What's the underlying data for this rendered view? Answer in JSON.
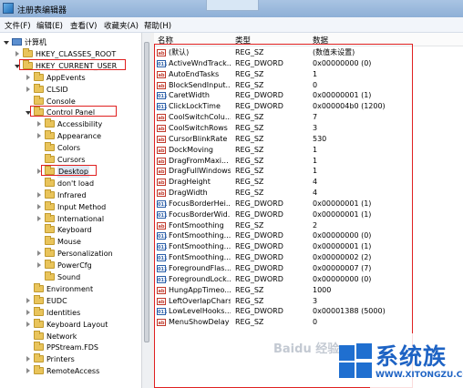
{
  "window": {
    "title": "注册表编辑器"
  },
  "menu": [
    "文件(F)",
    "编辑(E)",
    "查看(V)",
    "收藏夹(A)",
    "帮助(H)"
  ],
  "tree": [
    {
      "label": "计算机",
      "level": 0,
      "state": "open",
      "icon": "computer-icon"
    },
    {
      "label": "HKEY_CLASSES_ROOT",
      "level": 1,
      "state": "closed",
      "icon": "folder-icon"
    },
    {
      "label": "HKEY_CURRENT_USER",
      "level": 1,
      "state": "open",
      "icon": "folder-icon",
      "highlight": true
    },
    {
      "label": "AppEvents",
      "level": 2,
      "state": "closed",
      "icon": "folder-icon"
    },
    {
      "label": "CLSID",
      "level": 2,
      "state": "closed",
      "icon": "folder-icon"
    },
    {
      "label": "Console",
      "level": 2,
      "state": "none",
      "icon": "folder-icon"
    },
    {
      "label": "Control Panel",
      "level": 2,
      "state": "open",
      "icon": "folder-icon",
      "highlight": true
    },
    {
      "label": "Accessibility",
      "level": 3,
      "state": "closed",
      "icon": "folder-icon"
    },
    {
      "label": "Appearance",
      "level": 3,
      "state": "closed",
      "icon": "folder-icon"
    },
    {
      "label": "Colors",
      "level": 3,
      "state": "none",
      "icon": "folder-icon"
    },
    {
      "label": "Cursors",
      "level": 3,
      "state": "none",
      "icon": "folder-icon"
    },
    {
      "label": "Desktop",
      "level": 3,
      "state": "closed",
      "icon": "folder-icon",
      "highlight": true,
      "selected": true
    },
    {
      "label": "don't load",
      "level": 3,
      "state": "none",
      "icon": "folder-icon"
    },
    {
      "label": "Infrared",
      "level": 3,
      "state": "closed",
      "icon": "folder-icon"
    },
    {
      "label": "Input Method",
      "level": 3,
      "state": "closed",
      "icon": "folder-icon"
    },
    {
      "label": "International",
      "level": 3,
      "state": "closed",
      "icon": "folder-icon"
    },
    {
      "label": "Keyboard",
      "level": 3,
      "state": "none",
      "icon": "folder-icon"
    },
    {
      "label": "Mouse",
      "level": 3,
      "state": "none",
      "icon": "folder-icon"
    },
    {
      "label": "Personalization",
      "level": 3,
      "state": "closed",
      "icon": "folder-icon"
    },
    {
      "label": "PowerCfg",
      "level": 3,
      "state": "closed",
      "icon": "folder-icon"
    },
    {
      "label": "Sound",
      "level": 3,
      "state": "none",
      "icon": "folder-icon"
    },
    {
      "label": "Environment",
      "level": 2,
      "state": "none",
      "icon": "folder-icon"
    },
    {
      "label": "EUDC",
      "level": 2,
      "state": "closed",
      "icon": "folder-icon"
    },
    {
      "label": "Identities",
      "level": 2,
      "state": "closed",
      "icon": "folder-icon"
    },
    {
      "label": "Keyboard Layout",
      "level": 2,
      "state": "closed",
      "icon": "folder-icon"
    },
    {
      "label": "Network",
      "level": 2,
      "state": "none",
      "icon": "folder-icon"
    },
    {
      "label": "PPStream.FDS",
      "level": 2,
      "state": "none",
      "icon": "folder-icon"
    },
    {
      "label": "Printers",
      "level": 2,
      "state": "closed",
      "icon": "folder-icon"
    },
    {
      "label": "RemoteAccess",
      "level": 2,
      "state": "closed",
      "icon": "folder-icon"
    }
  ],
  "columns": {
    "name": "名称",
    "type": "类型",
    "data": "数据"
  },
  "values": [
    {
      "name": "(默认)",
      "type": "REG_SZ",
      "data": "(数值未设置)"
    },
    {
      "name": "ActiveWndTrack...",
      "type": "REG_DWORD",
      "data": "0x00000000 (0)"
    },
    {
      "name": "AutoEndTasks",
      "type": "REG_SZ",
      "data": "1"
    },
    {
      "name": "BlockSendInput...",
      "type": "REG_SZ",
      "data": "0"
    },
    {
      "name": "CaretWidth",
      "type": "REG_DWORD",
      "data": "0x00000001 (1)"
    },
    {
      "name": "ClickLockTime",
      "type": "REG_DWORD",
      "data": "0x000004b0 (1200)"
    },
    {
      "name": "CoolSwitchColu...",
      "type": "REG_SZ",
      "data": "7"
    },
    {
      "name": "CoolSwitchRows",
      "type": "REG_SZ",
      "data": "3"
    },
    {
      "name": "CursorBlinkRate",
      "type": "REG_SZ",
      "data": "530"
    },
    {
      "name": "DockMoving",
      "type": "REG_SZ",
      "data": "1"
    },
    {
      "name": "DragFromMaxi...",
      "type": "REG_SZ",
      "data": "1"
    },
    {
      "name": "DragFullWindows",
      "type": "REG_SZ",
      "data": "1"
    },
    {
      "name": "DragHeight",
      "type": "REG_SZ",
      "data": "4"
    },
    {
      "name": "DragWidth",
      "type": "REG_SZ",
      "data": "4"
    },
    {
      "name": "FocusBorderHei...",
      "type": "REG_DWORD",
      "data": "0x00000001 (1)"
    },
    {
      "name": "FocusBorderWid...",
      "type": "REG_DWORD",
      "data": "0x00000001 (1)"
    },
    {
      "name": "FontSmoothing",
      "type": "REG_SZ",
      "data": "2"
    },
    {
      "name": "FontSmoothing...",
      "type": "REG_DWORD",
      "data": "0x00000000 (0)"
    },
    {
      "name": "FontSmoothing...",
      "type": "REG_DWORD",
      "data": "0x00000001 (1)"
    },
    {
      "name": "FontSmoothing...",
      "type": "REG_DWORD",
      "data": "0x00000002 (2)"
    },
    {
      "name": "ForegroundFlas...",
      "type": "REG_DWORD",
      "data": "0x00000007 (7)"
    },
    {
      "name": "ForegroundLock...",
      "type": "REG_DWORD",
      "data": "0x00000000 (0)"
    },
    {
      "name": "HungAppTimeo...",
      "type": "REG_SZ",
      "data": "1000"
    },
    {
      "name": "LeftOverlapChars",
      "type": "REG_SZ",
      "data": "3"
    },
    {
      "name": "LowLevelHooks...",
      "type": "REG_DWORD",
      "data": "0x00001388 (5000)"
    },
    {
      "name": "MenuShowDelay",
      "type": "REG_SZ",
      "data": "0"
    }
  ],
  "watermark": {
    "title": "系统族",
    "url": "WWW.XITONGZU.COM",
    "baidu": "Baidu 经验"
  },
  "colors": {
    "highlight": "#e02020",
    "accent": "#1e63c4"
  }
}
